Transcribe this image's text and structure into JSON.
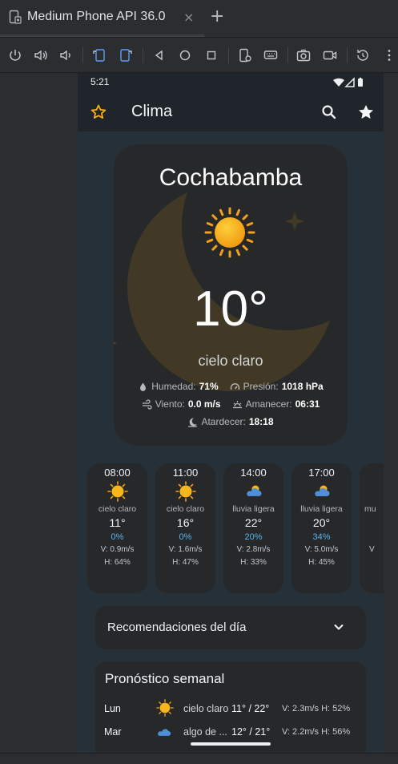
{
  "ide": {
    "tab_title": "Medium Phone API 36.0",
    "close_glyph": "×",
    "add_glyph": "+"
  },
  "toolbar": {
    "icons": [
      "power-icon",
      "volume-up-icon",
      "volume-down-icon",
      "rotate-left-icon",
      "rotate-right-icon",
      "back-icon",
      "home-icon",
      "overview-icon",
      "device-settings-icon",
      "keyboard-icon",
      "camera-icon",
      "video-icon",
      "snapshot-icon",
      "more-icon"
    ]
  },
  "phone": {
    "status_time": "5:21",
    "app_title": "Clima",
    "colors": {
      "accent_star": "#f5b20a",
      "rain_blue": "#5ab4f0",
      "card_bg": "#262829",
      "bg": "#253039"
    }
  },
  "current": {
    "city": "Cochabamba",
    "temp": "10°",
    "description": "cielo claro",
    "humidity_label": "Humedad:",
    "humidity_value": "71%",
    "pressure_label": "Presión:",
    "pressure_value": "1018 hPa",
    "wind_label": "Viento:",
    "wind_value": "0.0 m/s",
    "sunrise_label": "Amanecer:",
    "sunrise_value": "06:31",
    "sunset_label": "Atardecer:",
    "sunset_value": "18:18"
  },
  "hourly": [
    {
      "time": "08:00",
      "icon": "sun-icon",
      "desc": "cielo claro",
      "temp": "11°",
      "rain": "0%",
      "wind": "V: 0.9m/s",
      "hum": "H: 64%"
    },
    {
      "time": "11:00",
      "icon": "sun-icon",
      "desc": "cielo claro",
      "temp": "16°",
      "rain": "0%",
      "wind": "V: 1.6m/s",
      "hum": "H: 47%"
    },
    {
      "time": "14:00",
      "icon": "rain-cloud-icon",
      "desc": "lluvia ligera",
      "temp": "22°",
      "rain": "20%",
      "wind": "V: 2.8m/s",
      "hum": "H: 33%"
    },
    {
      "time": "17:00",
      "icon": "rain-cloud-icon",
      "desc": "lluvia ligera",
      "temp": "20°",
      "rain": "34%",
      "wind": "V: 5.0m/s",
      "hum": "H: 45%"
    },
    {
      "time": "",
      "icon": "",
      "desc": "mu",
      "temp": "",
      "rain": "",
      "wind": "V",
      "hum": ""
    }
  ],
  "recommendations": {
    "title": "Recomendaciones del día"
  },
  "weekly": {
    "title": "Pronóstico semanal",
    "rows": [
      {
        "day": "Lun",
        "icon": "sun-icon",
        "desc": "cielo claro",
        "temp": "11° / 22°",
        "wind": "V: 2.3m/s H: 52%"
      },
      {
        "day": "Mar",
        "icon": "rain-cloud-icon",
        "desc": "algo de ...",
        "temp": "12° / 21°",
        "wind": "V: 2.2m/s H: 56%"
      }
    ]
  }
}
